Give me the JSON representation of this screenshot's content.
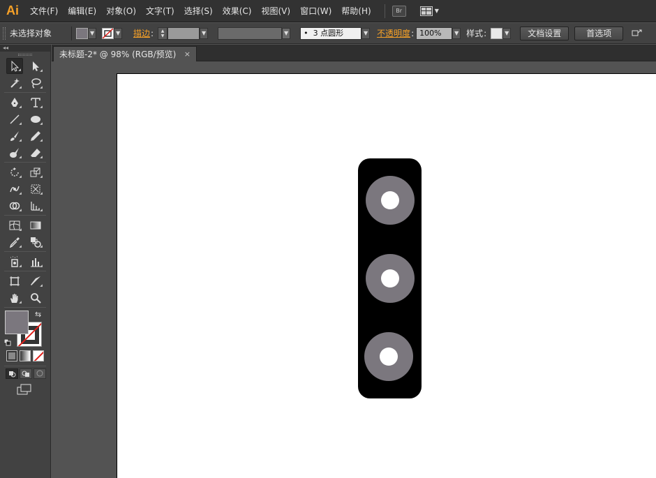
{
  "app": {
    "logo": "Ai"
  },
  "menu": [
    "文件(F)",
    "编辑(E)",
    "对象(O)",
    "文字(T)",
    "选择(S)",
    "效果(C)",
    "视图(V)",
    "窗口(W)",
    "帮助(H)"
  ],
  "menu_extras": {
    "bridge_label": "Br",
    "workspace_icon": "workspace-switcher-icon"
  },
  "controlbar": {
    "selection_status": "未选择对象",
    "fill_color": "#7b777e",
    "stroke_label": "描边",
    "brush_value": "3 点圆形",
    "brush_bullet": "•",
    "opacity_label": "不透明度",
    "opacity_value": "100%",
    "style_label": "样式",
    "doc_setup_button": "文档设置",
    "preferences_button": "首选项"
  },
  "toolpanel": {
    "collapse_glyph": "◂◂"
  },
  "document": {
    "tab_title": "未标题-2* @ 98% (RGB/预览)",
    "close_glyph": "×"
  },
  "artwork": {
    "body_color": "#000000",
    "ring_color": "#7b777e",
    "hole_color": "#ffffff",
    "ring_count": 3
  },
  "colors": {
    "accent": "#f7a127",
    "panel": "#424242",
    "menubar": "#323232",
    "canvas": "#535353"
  }
}
